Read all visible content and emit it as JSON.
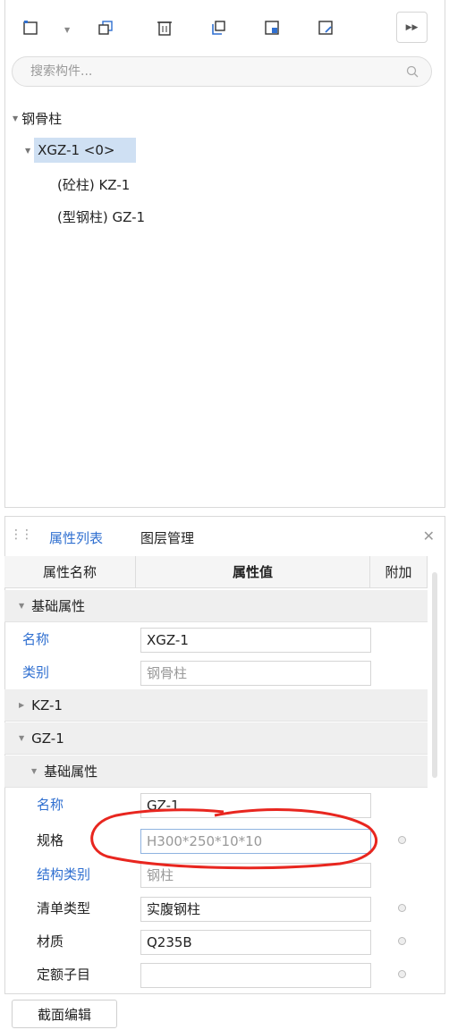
{
  "search": {
    "placeholder": "搜索构件..."
  },
  "tree": {
    "root": "钢骨柱",
    "child": "XGZ-1 <0>",
    "leaves": [
      "(砼柱) KZ-1",
      "(型钢柱) GZ-1"
    ]
  },
  "tabs": {
    "properties": "属性列表",
    "layers": "图层管理"
  },
  "columns": {
    "name": "属性名称",
    "value": "属性值",
    "extra": "附加"
  },
  "groups": {
    "basic": "基础属性",
    "kz": "KZ-1",
    "gz": "GZ-1",
    "gz_basic": "基础属性"
  },
  "rows": [
    {
      "name": "名称",
      "value": "XGZ-1"
    },
    {
      "name": "类别",
      "value": "钢骨柱"
    },
    {
      "name": "名称",
      "value": "GZ-1"
    },
    {
      "name": "规格",
      "value": "H300*250*10*10"
    },
    {
      "name": "结构类别",
      "value": "钢柱"
    },
    {
      "name": "清单类型",
      "value": "实腹钢柱"
    },
    {
      "name": "材质",
      "value": "Q235B"
    },
    {
      "name": "定额子目",
      "value": ""
    }
  ],
  "footer": {
    "edit_section": "截面编辑"
  },
  "colors": {
    "selection": "#cfe0f3",
    "accent": "#2f6fd0",
    "annotation": "#e8261f"
  },
  "icons": [
    "new-component-icon",
    "copy-icon",
    "delete-icon",
    "copy-to-floor-icon",
    "import-icon",
    "export-icon",
    "more-icon",
    "search-icon",
    "close-icon"
  ]
}
